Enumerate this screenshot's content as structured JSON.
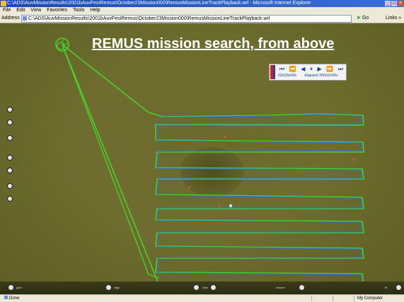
{
  "window": {
    "title": "C:\\ADS\\AuvMissionResults\\2001bAuvFestRemus\\October23Mission000\\RemusMissionLineTrackPlayback.wrl - Microsoft Internet Explorer",
    "controls": [
      "_",
      "□",
      "×"
    ]
  },
  "menubar": {
    "items": [
      "File",
      "Edit",
      "View",
      "Favorites",
      "Tools",
      "Help"
    ]
  },
  "addressbar": {
    "label": "Address",
    "value": "C:\\ADS\\AuvMissionResults\\2001bAuvFestRemus\\October23Mission000\\RemusMissionLineTrackPlayback.wrl",
    "go_label": "Go",
    "links_label": "Links »"
  },
  "slide": {
    "title": "REMUS mission search, from above"
  },
  "playback": {
    "buttons": [
      "⏮",
      "⏪",
      "◀",
      "⏸",
      "▶",
      "⏩",
      "⏭"
    ],
    "time": "01h23m00s",
    "elapsed": "Elapsed: 00h01m56s"
  },
  "track": {
    "colors": {
      "inner_track": "#2f6fd8",
      "outer_track": "#46d12b",
      "marker": "#e05a2a"
    }
  },
  "bottombar": {
    "controls": [
      {
        "label": "goto",
        "icon": "circle-button-icon"
      },
      {
        "label": "align",
        "icon": "circle-button-icon"
      },
      {
        "label": "view",
        "icon": "circle-button-icon"
      },
      {
        "label": "restore",
        "icon": "circle-button-icon"
      },
      {
        "label": "fit",
        "icon": "circle-button-icon"
      }
    ]
  },
  "statusbar": {
    "left": "Done",
    "zone": "My Computer"
  }
}
